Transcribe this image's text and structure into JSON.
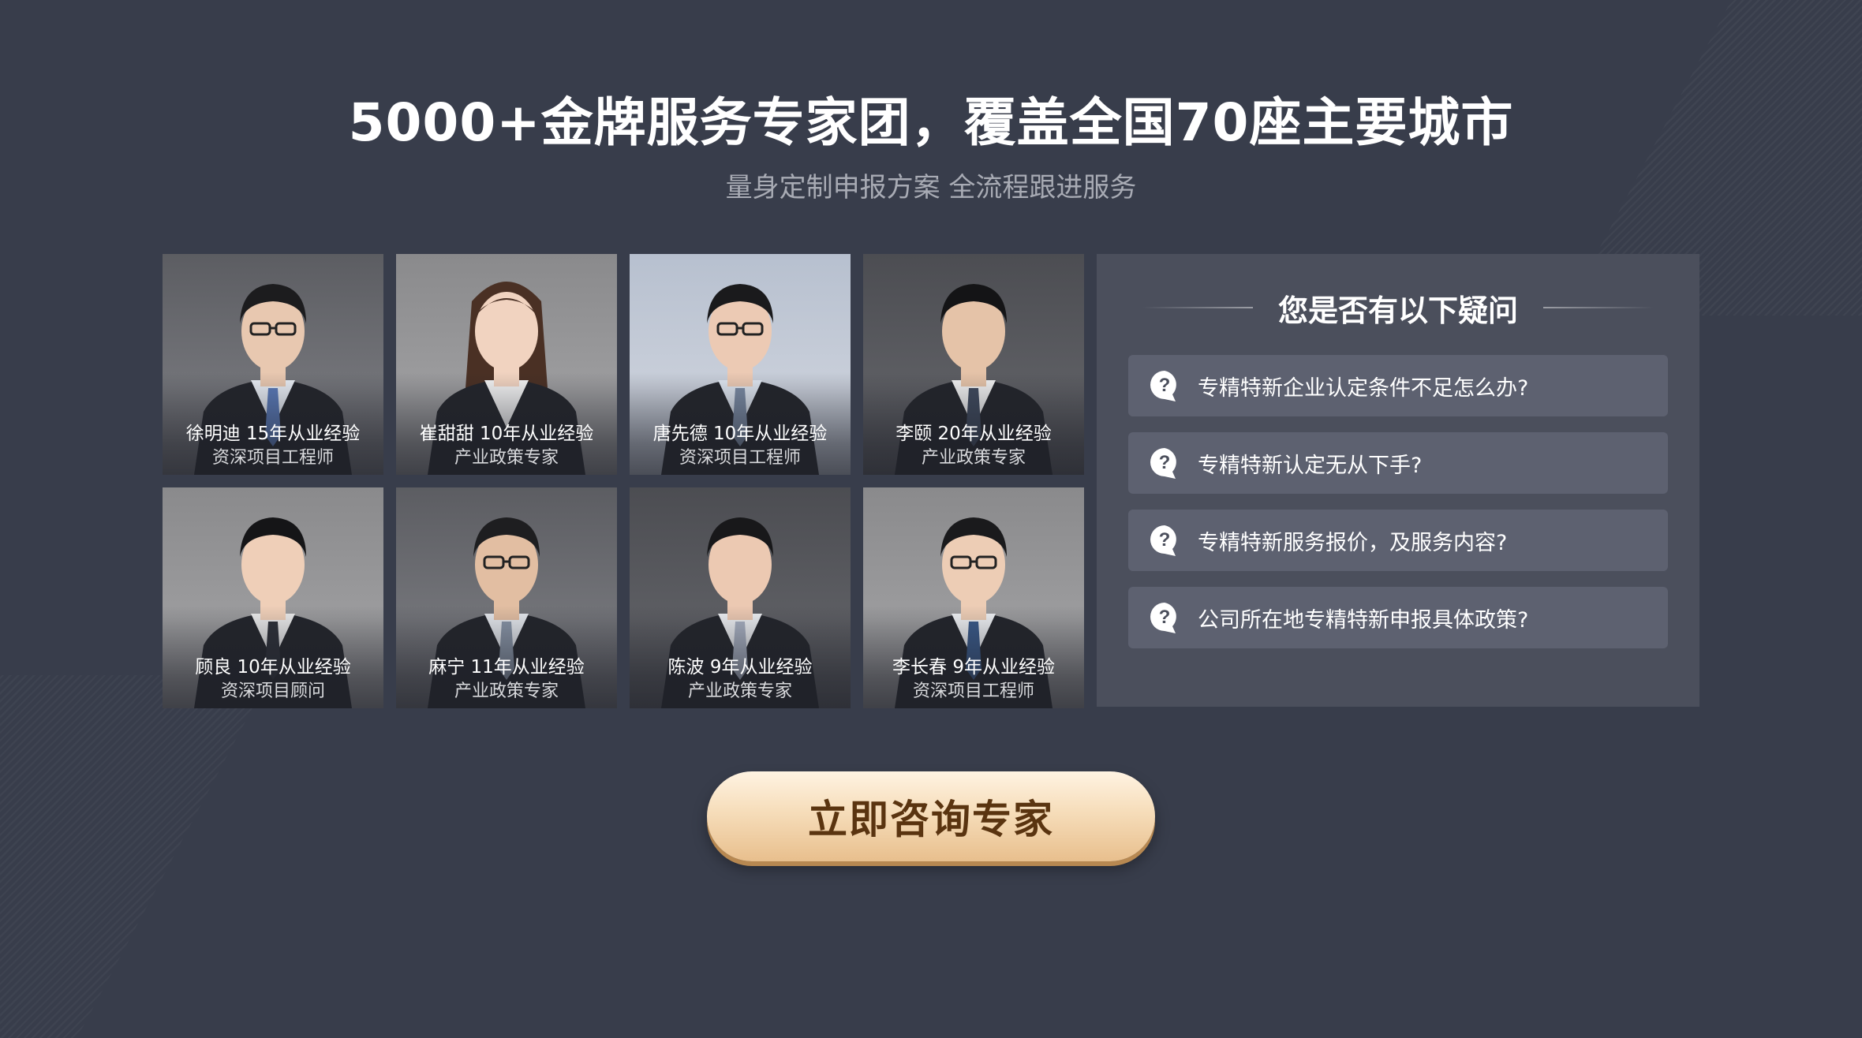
{
  "hero": {
    "title": "5000+金牌服务专家团，覆盖全国70座主要城市",
    "subtitle": "量身定制申报方案 全流程跟进服务"
  },
  "experts": [
    {
      "name_line": "徐明迪 15年从业经验",
      "role": "资深项目工程师",
      "tie_color": "#5a7ab8",
      "shirt": "#e9eef5"
    },
    {
      "name_line": "崔甜甜 10年从业经验",
      "role": "产业政策专家",
      "tie_color": "#e9e9ea",
      "shirt": "#f4f4f4"
    },
    {
      "name_line": "唐先德 10年从业经验",
      "role": "资深项目工程师",
      "tie_color": "#7a8aa3",
      "shirt": "#dfe6f0"
    },
    {
      "name_line": "李颐 20年从业经验",
      "role": "产业政策专家",
      "tie_color": "#3f4a5e",
      "shirt": "#f2f2f2"
    },
    {
      "name_line": "顾良 10年从业经验",
      "role": "资深项目顾问",
      "tie_color": "#2d3038",
      "shirt": "#ececec"
    },
    {
      "name_line": "麻宁 11年从业经验",
      "role": "产业政策专家",
      "tie_color": "#8a96a8",
      "shirt": "#e6e9ee"
    },
    {
      "name_line": "陈波 9年从业经验",
      "role": "产业政策专家",
      "tie_color": "#a9b1c2",
      "shirt": "#eef0f3"
    },
    {
      "name_line": "李长春 9年从业经验",
      "role": "资深项目工程师",
      "tie_color": "#3a5a8a",
      "shirt": "#f0f2f5"
    }
  ],
  "faq": {
    "title": "您是否有以下疑问",
    "questions": [
      "专精特新企业认定条件不足怎么办?",
      "专精特新认定无从下手?",
      "专精特新服务报价，及服务内容?",
      "公司所在地专精特新申报具体政策?"
    ]
  },
  "cta": {
    "label": "立即咨询专家"
  },
  "colors": {
    "background": "#383d4b",
    "panel": "#4b4f5c",
    "question_bg": "#5d6170",
    "cta_gold": "#f6ddba",
    "cta_text": "#5a3410"
  }
}
